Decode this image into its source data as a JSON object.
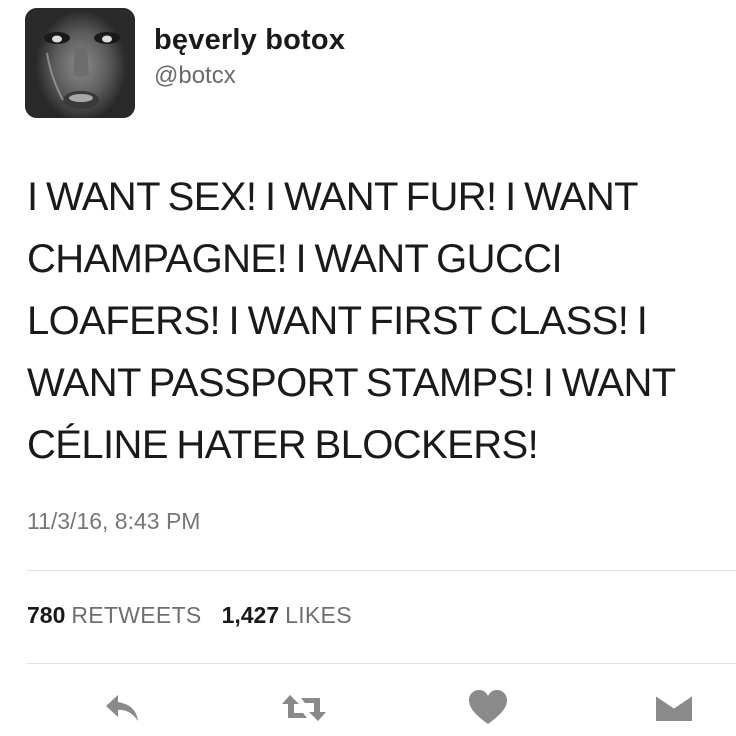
{
  "user": {
    "display_name": "bęverly botox",
    "handle": "@botcx",
    "avatar": "profile-photo-icon"
  },
  "tweet": {
    "text": "I WANT SEX! I WANT FUR! I WANT CHAMPAGNE! I WANT GUCCI LOAFERS! I WANT FIRST CLASS! I WANT PASSPORT STAMPS! I WANT CÉLINE HATER BLOCKERS!",
    "timestamp": "11/3/16, 8:43 PM"
  },
  "stats": {
    "retweets_count": "780",
    "retweets_label": "RETWEETS",
    "likes_count": "1,427",
    "likes_label": "LIKES"
  },
  "actions": [
    {
      "name": "reply",
      "icon": "reply-icon"
    },
    {
      "name": "retweet",
      "icon": "retweet-icon"
    },
    {
      "name": "like",
      "icon": "heart-icon"
    },
    {
      "name": "direct-message",
      "icon": "envelope-icon"
    }
  ],
  "colors": {
    "text": "#1a1a1a",
    "muted": "#6b6b6b",
    "icon": "#8a8a8a",
    "divider": "#e3e3e3"
  }
}
